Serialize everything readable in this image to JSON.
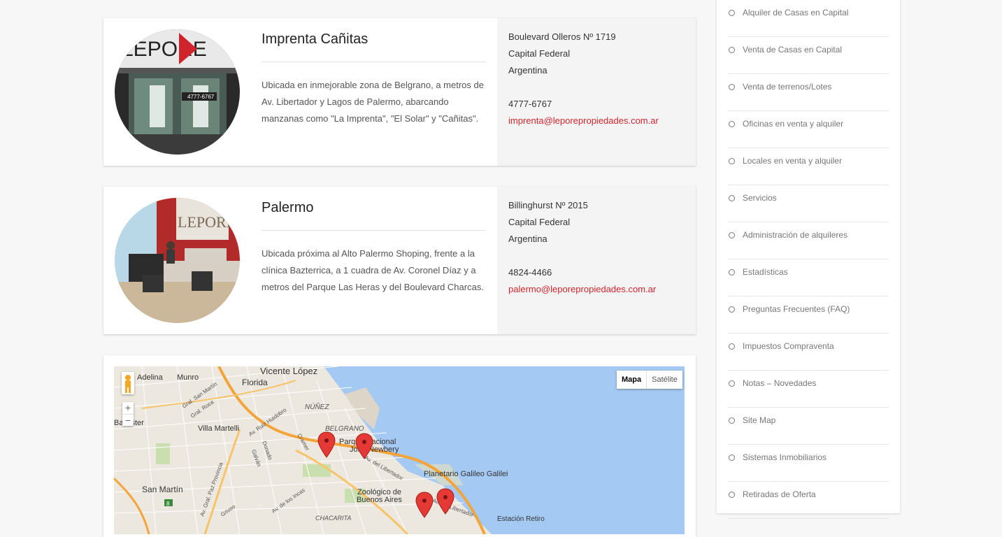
{
  "offices": [
    {
      "title": "Imprenta Cañitas",
      "description": "Ubicada en inmejorable zona de Belgrano, a metros de Av. Libertador y Lagos de Palermo, abarcando manzanas como \"La Imprenta\", \"El Solar\" y \"Cañitas\".",
      "address_line1": "Boulevard Olleros Nº 1719",
      "address_line2": "Capital Federal",
      "address_line3": "Argentina",
      "phone": "4777-6767",
      "email": "imprenta@leporepropiedades.com.ar",
      "photo_sign": "LEPORE",
      "photo_phone": "4777-6767"
    },
    {
      "title": "Palermo",
      "description": "Ubicada próxima al Alto Palermo Shoping, frente a la clínica Bazterrica, a 1 cuadra de Av. Coronel Díaz y a metros del Parque Las Heras y del Boulevard Charcas.",
      "address_line1": "Billinghurst Nº 2015",
      "address_line2": "Capital Federal",
      "address_line3": "Argentina",
      "phone": "4824-4466",
      "email": "palermo@leporepropiedades.com.ar",
      "photo_sign": "LEPORE"
    }
  ],
  "map": {
    "type_map": "Mapa",
    "type_satellite": "Satélite",
    "zoom_in": "+",
    "zoom_out": "−",
    "labels": {
      "vicente_lopez": "Vicente López",
      "adelina": "Adelina",
      "munro": "Munro",
      "florida": "Florida",
      "nunez": "NÚÑEZ",
      "villa_martelli": "Villa Martelli",
      "belgrano": "BELGRANO",
      "parque": "Parque Nacional",
      "parque_prefix": "A",
      "jonewbery": "John Newbery",
      "planetario": "Planetario Galileo Galilei",
      "zoologico1": "Zoológico de",
      "zoologico2": "Buenos Aires",
      "san_martin": "San Martín",
      "chacarita": "CHACARITA",
      "estacion": "Estación Retiro",
      "ballester": "Ballester",
      "gral_san_martin": "Gral. San Martín",
      "gral_roca": "Gral. Roca",
      "ruiz_huidobro": "Av. Ruiz Huidobro",
      "donado": "Donado",
      "galvan": "Galván",
      "cramer": "Cramer",
      "libertador": "Av. del Libertador",
      "libertador2": "Av. del Libertador",
      "de_los_incas": "Av. de los Incas",
      "gral_paz": "Av. Gral. Paz Provincia",
      "griveo": "Griveo",
      "route8": "8"
    }
  },
  "sidebar": {
    "items": [
      "Alquiler de Casas en Capital",
      "Venta de Casas en Capital",
      "Venta de terrenos/Lotes",
      "Oficinas en venta y alquiler",
      "Locales en venta y alquiler",
      "Servicios",
      "Administración de alquileres",
      "Estadísticas",
      "Preguntas Frecuentes (FAQ)",
      "Impuestos Compraventa",
      "Notas – Novedades",
      "Site Map",
      "Sistemas Inmobiliarios",
      "Retiradas de Oferta"
    ]
  }
}
